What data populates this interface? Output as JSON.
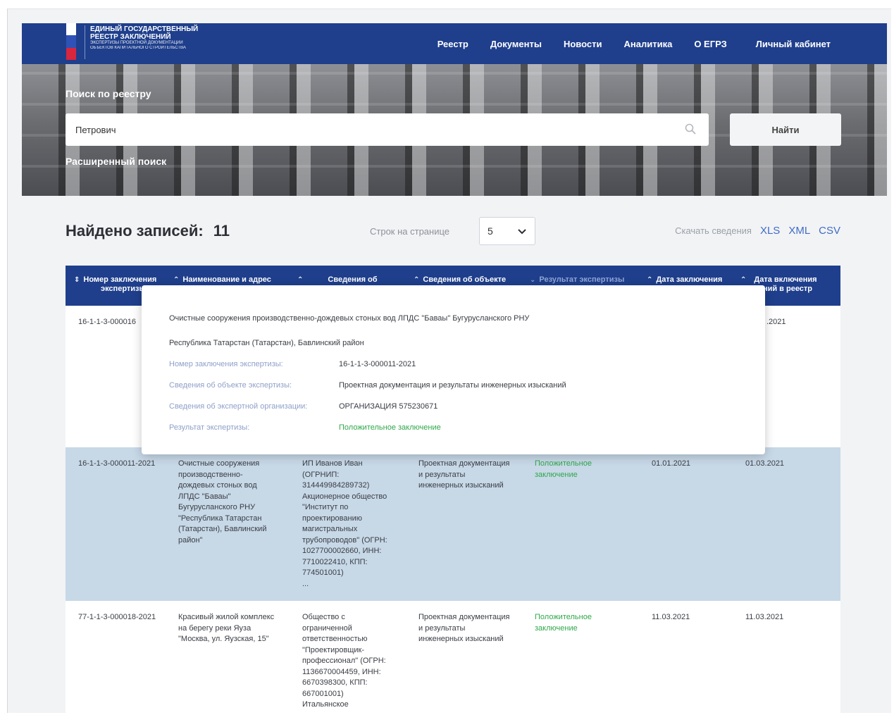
{
  "header": {
    "logo_lines": [
      "ЕДИНЫЙ ГОСУДАРСТВЕННЫЙ",
      "РЕЕСТР ЗАКЛЮЧЕНИЙ"
    ],
    "logo_sub_lines": [
      "ЭКСПЕРТИЗЫ ПРОЕКТНОЙ ДОКУМЕНТАЦИИ",
      "ОБЪЕКТОВ КАПИТАЛЬНОГО СТРОИТЕЛЬСТВА"
    ],
    "nav": [
      "Реестр",
      "Документы",
      "Новости",
      "Аналитика",
      "О ЕГРЗ",
      "Личный кабинет"
    ]
  },
  "search": {
    "title": "Поиск по реестру",
    "value": "Петрович",
    "button": "Найти",
    "advanced": "Расширенный поиск"
  },
  "results": {
    "found_label": "Найдено записей:",
    "found_count": "11",
    "rows_label": "Строк на странице",
    "rows_value": "5",
    "download_label": "Скачать сведения",
    "formats": [
      "XLS",
      "XML",
      "CSV"
    ]
  },
  "table": {
    "columns": [
      {
        "label": "Номер заключения",
        "label2": "экспертизы"
      },
      {
        "label": "Наименование и адрес",
        "label2": ""
      },
      {
        "label": "Сведения об",
        "label2": ""
      },
      {
        "label": "Сведения об объекте",
        "label2": ""
      },
      {
        "label": "Результат экспертизы",
        "label2": ""
      },
      {
        "label": "Дата заключения",
        "label2": ""
      },
      {
        "label": "Дата включения",
        "label2": "сведений в реестр"
      }
    ],
    "rows": [
      {
        "number": "16-1-1-3-000016",
        "date_incl": ".2021"
      },
      {
        "number": "16-1-1-3-000011-2021",
        "name": [
          "Очистные сооружения",
          "производственно-",
          "дождевых стоных вод",
          "ЛПДС \"Баваы\"",
          "Бугурусланского РНУ",
          "\"Республика Татарстан",
          "(Татарстан), Бавлинский",
          "район\""
        ],
        "org": [
          "ИП Иванов Иван",
          "(ОГРНИП:",
          "314449984289732)",
          "Акционерное общество",
          "\"Институт по",
          "проектированию",
          "магистральных",
          "трубопроводов\" (ОГРН:",
          "1027700002660, ИНН:",
          "7710022410, КПП:",
          "774501001)",
          "..."
        ],
        "object": [
          "Проектная документация",
          "и результаты",
          "инженерных изысканий"
        ],
        "result": [
          "Положительное",
          "заключение"
        ],
        "date_concl": "01.01.2021",
        "date_incl": "01.03.2021"
      },
      {
        "number": "77-1-1-3-000018-2021",
        "name": [
          "Красивый жилой комплекс",
          "на берегу реки Яуза",
          "\"Москва, ул. Яузская, 15\""
        ],
        "org": [
          "Общество с",
          "ограниченной",
          "ответственностью",
          "\"Проектировщик-",
          "профессионал\" (ОГРН:",
          "1136670004459, ИНН:",
          "6670398300, КПП:",
          "667001001)",
          "Итальянское"
        ],
        "object": [
          "Проектная документация",
          "и результаты",
          "инженерных изысканий"
        ],
        "result": [
          "Положительное",
          "заключение"
        ],
        "date_concl": "11.03.2021",
        "date_incl": "11.03.2021"
      }
    ]
  },
  "popup": {
    "title": "Очистные сооружения производственно-дождевых стоных вод ЛПДС \"Баваы\" Бугурусланского РНУ",
    "address": "Республика Татарстан (Татарстан), Бавлинский район",
    "fields": [
      {
        "key": "Номер заключения экспертизы:",
        "value": "16-1-1-3-000011-2021"
      },
      {
        "key": "Сведения об объекте экспертизы:",
        "value": "Проектная документация и результаты инженерных изысканий"
      },
      {
        "key": "Сведения об экспертной организации:",
        "value": "ОРГАНИЗАЦИЯ 575230671"
      },
      {
        "key": "Результат экспертизы:",
        "value": "Положительное заключение"
      }
    ]
  },
  "colors": {
    "brand_blue": "#1f3f8c",
    "highlight_row": "#c7d8e7",
    "positive_green": "#2fa84a",
    "link_blue": "#3f6cc5"
  }
}
